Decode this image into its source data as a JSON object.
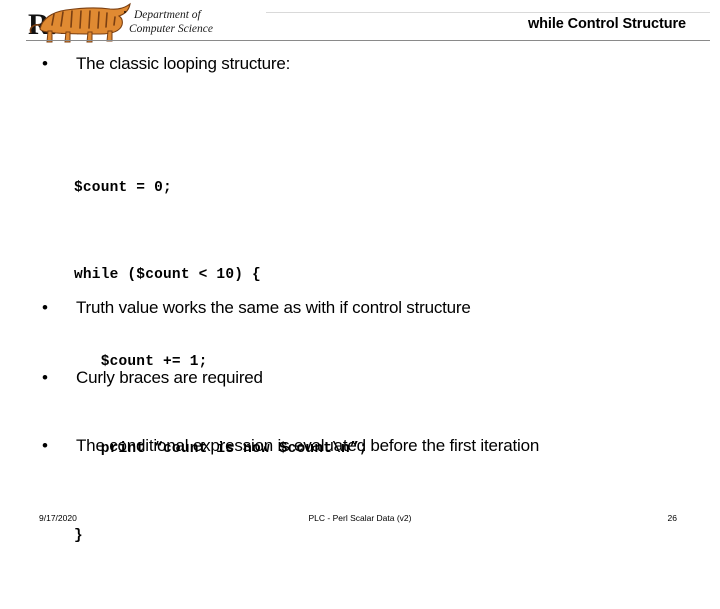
{
  "header": {
    "logo": {
      "icon": "rit-tiger-logo",
      "wordmark": "R.I.T.",
      "department_line1": "Department of",
      "department_line2": "Computer Science",
      "tiger_color": "#E08A32",
      "tiger_stripe_color": "#7A3F12",
      "wordmark_color": "#000000"
    },
    "title": "while Control Structure",
    "rule_color": "#8a8a8a"
  },
  "body": {
    "bullets": [
      {
        "marker": "•",
        "text": "The classic looping structure:"
      },
      {
        "marker": "•",
        "text": "Truth value works the same as with if control structure"
      },
      {
        "marker": "•",
        "text": "Curly braces are required"
      },
      {
        "marker": "•",
        "text": "The conditional expression is evaluated before the first iteration"
      }
    ],
    "code": {
      "language": "perl",
      "lines": [
        "$count = 0;",
        "while ($count < 10) {",
        "   $count += 1;",
        "   print “count is now $count\\n”;",
        "}"
      ]
    }
  },
  "footer": {
    "date": "9/17/2020",
    "deck_title": "PLC - Perl Scalar Data (v2)",
    "page_number": "26"
  }
}
